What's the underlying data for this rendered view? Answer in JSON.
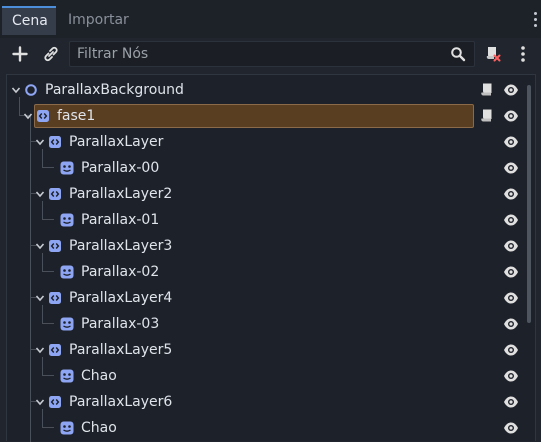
{
  "tabs": [
    {
      "label": "Cena",
      "active": true
    },
    {
      "label": "Importar",
      "active": false
    }
  ],
  "toolbar": {
    "add_icon": "plus-icon",
    "link_icon": "link-icon",
    "filter_placeholder": "Filtrar Nós",
    "filter_value": "",
    "search_icon": "search-icon",
    "script_remove_icon": "script-remove-icon",
    "menu_icon": "kebab-menu-icon"
  },
  "tree": {
    "nodes": [
      {
        "label": "ParallaxBackground",
        "type": "node",
        "depth": 0,
        "expanded": true,
        "script": true,
        "visible": true
      },
      {
        "label": "fase1",
        "type": "node2d",
        "depth": 1,
        "expanded": true,
        "script": true,
        "visible": true,
        "selected": true
      },
      {
        "label": "ParallaxLayer",
        "type": "node2d",
        "depth": 2,
        "expanded": true,
        "visible": true
      },
      {
        "label": "Parallax-00",
        "type": "sprite",
        "depth": 3,
        "visible": true
      },
      {
        "label": "ParallaxLayer2",
        "type": "node2d",
        "depth": 2,
        "expanded": true,
        "visible": true
      },
      {
        "label": "Parallax-01",
        "type": "sprite",
        "depth": 3,
        "visible": true
      },
      {
        "label": "ParallaxLayer3",
        "type": "node2d",
        "depth": 2,
        "expanded": true,
        "visible": true
      },
      {
        "label": "Parallax-02",
        "type": "sprite",
        "depth": 3,
        "visible": true
      },
      {
        "label": "ParallaxLayer4",
        "type": "node2d",
        "depth": 2,
        "expanded": true,
        "visible": true
      },
      {
        "label": "Parallax-03",
        "type": "sprite",
        "depth": 3,
        "visible": true
      },
      {
        "label": "ParallaxLayer5",
        "type": "node2d",
        "depth": 2,
        "expanded": true,
        "visible": true
      },
      {
        "label": "Chao",
        "type": "sprite",
        "depth": 3,
        "visible": true
      },
      {
        "label": "ParallaxLayer6",
        "type": "node2d",
        "depth": 2,
        "expanded": true,
        "visible": true
      },
      {
        "label": "Chao",
        "type": "sprite",
        "depth": 3,
        "visible": true
      }
    ]
  },
  "colors": {
    "accent": "#4c8ed9",
    "node_icon": "#8da5f3",
    "sprite_icon": "#8da5f3",
    "selected_bg": "#5a3e22",
    "eye": "#e0e0e0",
    "remove_red": "#ff5f5f"
  }
}
